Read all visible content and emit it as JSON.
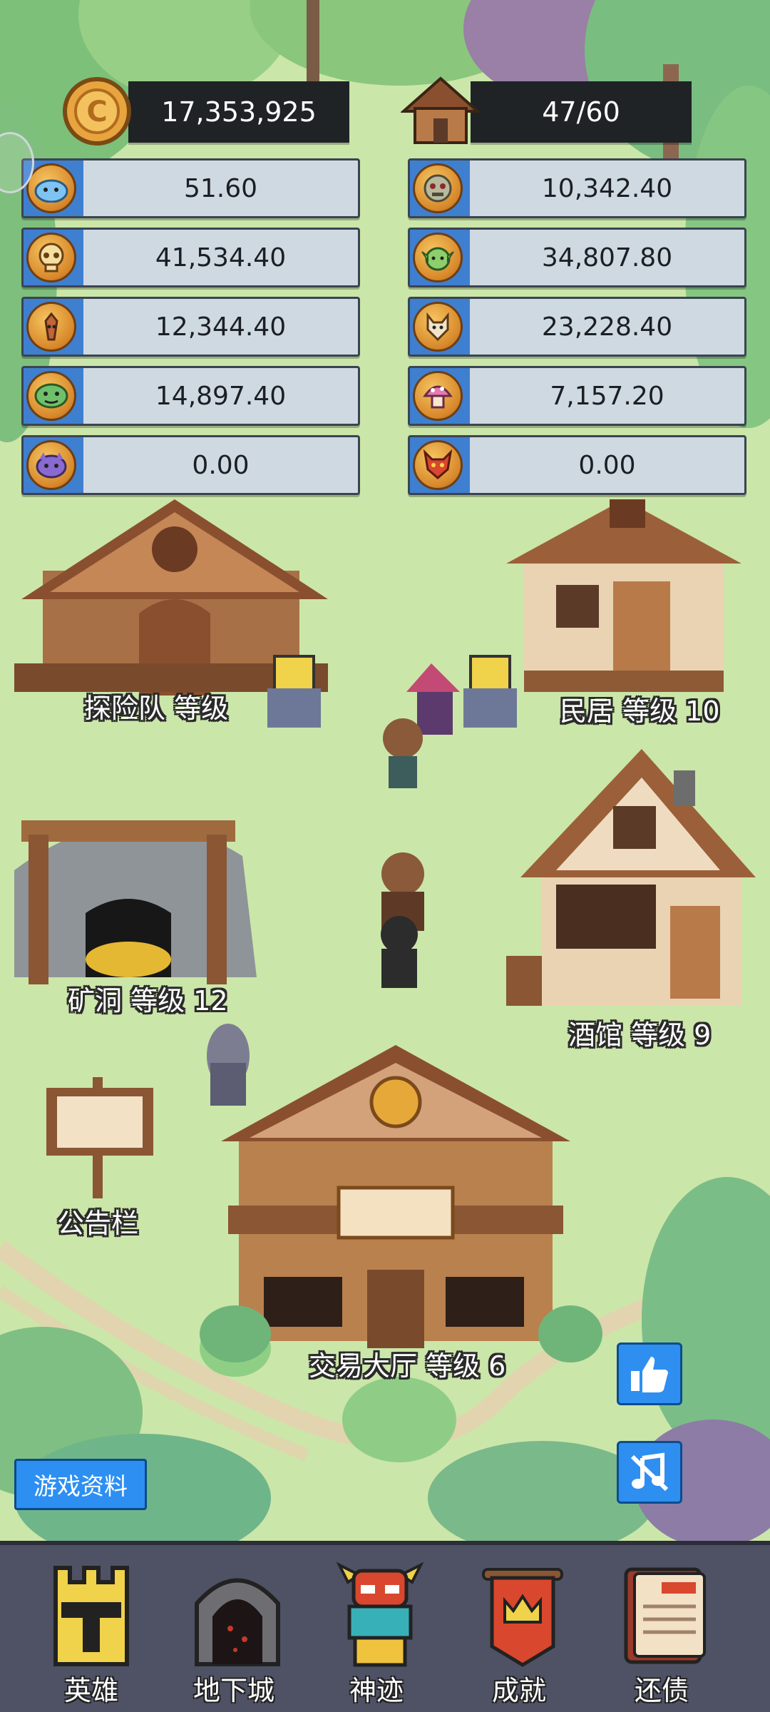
{
  "header": {
    "gold": "17,353,925",
    "housing": "47/60"
  },
  "resources": {
    "left": [
      {
        "icon": "slime-icon",
        "value": "51.60"
      },
      {
        "icon": "skull-icon",
        "value": "41,534.40"
      },
      {
        "icon": "treant-icon",
        "value": "12,344.40"
      },
      {
        "icon": "goblin-face-icon",
        "value": "14,897.40"
      },
      {
        "icon": "purple-beast-icon",
        "value": "0.00"
      }
    ],
    "right": [
      {
        "icon": "zombie-icon",
        "value": "10,342.40"
      },
      {
        "icon": "orc-icon",
        "value": "34,807.80"
      },
      {
        "icon": "wolf-icon",
        "value": "23,228.40"
      },
      {
        "icon": "mushroom-icon",
        "value": "7,157.20"
      },
      {
        "icon": "dragon-icon",
        "value": "0.00"
      }
    ]
  },
  "buildings": {
    "adventure_team": "探险队 等级",
    "residence": "民居 等级 10",
    "mine": "矿洞 等级 12",
    "tavern": "酒馆 等级 9",
    "bulletin": "公告栏",
    "trade_hall": "交易大厅 等级 6"
  },
  "buttons": {
    "game_info": "游戏资料"
  },
  "nav": {
    "items": [
      {
        "label": "英雄",
        "icon": "castle-tower-icon"
      },
      {
        "label": "地下城",
        "icon": "dungeon-gate-icon"
      },
      {
        "label": "神迹",
        "icon": "totem-icon"
      },
      {
        "label": "成就",
        "icon": "banner-crown-icon"
      },
      {
        "label": "还债",
        "icon": "ledger-book-icon"
      }
    ]
  },
  "colors": {
    "accent_blue": "#2f8ff0",
    "nav_bg": "#4f5264",
    "coin_gold": "#e0a040"
  }
}
